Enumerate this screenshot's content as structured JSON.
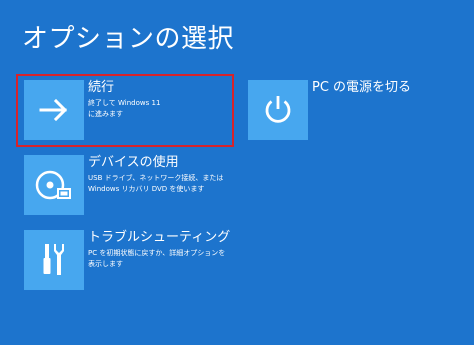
{
  "title": "オプションの選択",
  "options": [
    {
      "id": "continue",
      "label": "続行",
      "description": [
        "終了して Windows 11",
        "に進みます"
      ],
      "icon": "arrow-right-icon"
    },
    {
      "id": "use-device",
      "label": "デバイスの使用",
      "description": [
        "USB ドライブ、ネットワーク接続、または",
        "Windows リカバリ DVD を使います"
      ],
      "icon": "disc-usb-icon"
    },
    {
      "id": "troubleshoot",
      "label": "トラブルシューティング",
      "description": [
        "PC を初期状態に戻すか、詳細オプションを",
        "表示します"
      ],
      "icon": "tools-icon"
    },
    {
      "id": "power-off",
      "label": "PC の電源を切る",
      "description": [],
      "icon": "power-icon"
    }
  ],
  "colors": {
    "background": "#1d74cd",
    "tile": "#47a7ef",
    "highlight": "#d8232a"
  }
}
